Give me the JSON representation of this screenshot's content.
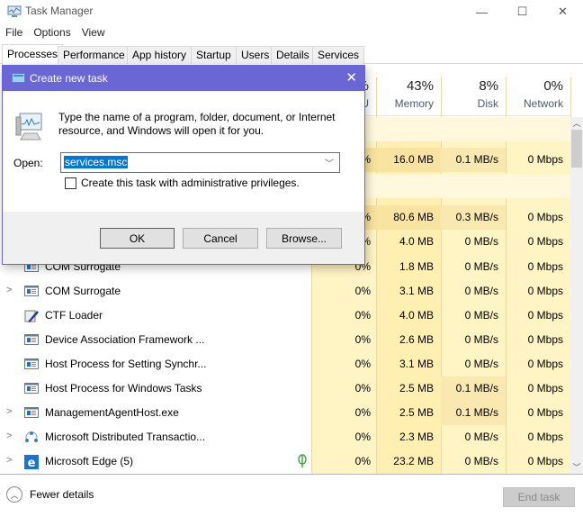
{
  "window": {
    "title": "Task Manager",
    "controls": {
      "minimize": "—",
      "maximize": "☐",
      "close": "✕"
    }
  },
  "menu": [
    "File",
    "Options",
    "View"
  ],
  "tabs": [
    "Processes",
    "Performance",
    "App history",
    "Startup",
    "Users",
    "Details",
    "Services"
  ],
  "active_tab": "Processes",
  "columns": {
    "cpu": {
      "pct": "%",
      "label": "U"
    },
    "memory": {
      "pct": "43%",
      "label": "Memory"
    },
    "disk": {
      "pct": "8%",
      "label": "Disk"
    },
    "network": {
      "pct": "0%",
      "label": "Network"
    }
  },
  "partial_rows": [
    {
      "cpu": "%",
      "memory": "16.0 MB",
      "disk": "0.1 MB/s",
      "network": "0 Mbps"
    },
    {
      "cpu": "%",
      "memory": "80.6 MB",
      "disk": "0.3 MB/s",
      "network": "0 Mbps"
    },
    {
      "cpu": "%",
      "memory": "4.0 MB",
      "disk": "0 MB/s",
      "network": "0 Mbps"
    }
  ],
  "processes": [
    {
      "name": "COM Surrogate",
      "expandable": false,
      "icon": "app-window-icon",
      "cpu": "0%",
      "memory": "1.8 MB",
      "disk": "0 MB/s",
      "network": "0 Mbps"
    },
    {
      "name": "COM Surrogate",
      "expandable": true,
      "icon": "app-window-icon",
      "cpu": "0%",
      "memory": "3.1 MB",
      "disk": "0 MB/s",
      "network": "0 Mbps"
    },
    {
      "name": "CTF Loader",
      "expandable": false,
      "icon": "ctf-pen-icon",
      "cpu": "0%",
      "memory": "4.0 MB",
      "disk": "0 MB/s",
      "network": "0 Mbps"
    },
    {
      "name": "Device Association Framework ...",
      "expandable": false,
      "icon": "app-window-icon",
      "cpu": "0%",
      "memory": "2.6 MB",
      "disk": "0 MB/s",
      "network": "0 Mbps"
    },
    {
      "name": "Host Process for Setting Synchr...",
      "expandable": false,
      "icon": "app-window-icon",
      "cpu": "0%",
      "memory": "3.1 MB",
      "disk": "0 MB/s",
      "network": "0 Mbps"
    },
    {
      "name": "Host Process for Windows Tasks",
      "expandable": false,
      "icon": "app-window-icon",
      "cpu": "0%",
      "memory": "2.5 MB",
      "disk": "0.1 MB/s",
      "network": "0 Mbps"
    },
    {
      "name": "ManagementAgentHost.exe",
      "expandable": true,
      "icon": "app-window-icon",
      "cpu": "0%",
      "memory": "2.5 MB",
      "disk": "0.1 MB/s",
      "network": "0 Mbps"
    },
    {
      "name": "Microsoft Distributed Transactio...",
      "expandable": true,
      "icon": "network-nodes-icon",
      "cpu": "0%",
      "memory": "2.3 MB",
      "disk": "0 MB/s",
      "network": "0 Mbps"
    },
    {
      "name": "Microsoft Edge (5)",
      "expandable": true,
      "icon": "edge-icon",
      "cpu": "0%",
      "memory": "23.2 MB",
      "disk": "0 MB/s",
      "network": "0 Mbps",
      "suspended_leaf": true
    }
  ],
  "footer": {
    "fewer_details": "Fewer details",
    "end_task": "End task"
  },
  "dialog": {
    "title": "Create new task",
    "message": "Type the name of a program, folder, document, or Internet resource, and Windows will open it for you.",
    "open_label": "Open:",
    "open_value": "services.msc",
    "admin_checkbox_label": "Create this task with administrative privileges.",
    "admin_checked": false,
    "ok": "OK",
    "cancel": "Cancel",
    "browse": "Browse..."
  },
  "colors": {
    "dialog_title_bg": "#6b66d6",
    "selection": "#0078d7",
    "heat_light": "#fff4c4",
    "heat_medium": "#f9e3a0"
  }
}
